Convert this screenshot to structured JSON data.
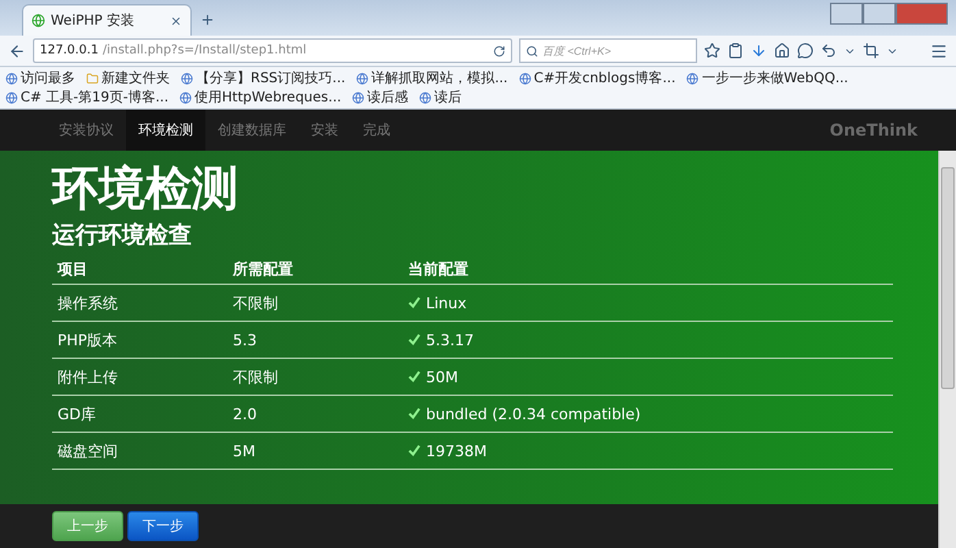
{
  "browser": {
    "tab": {
      "title": "WeiPHP 安装"
    },
    "address": {
      "host": "127.0.0.1",
      "path": "/install.php?s=/Install/step1.html"
    },
    "search": {
      "placeholder": "百度 <Ctrl+K>"
    },
    "bookmarks": [
      "访问最多",
      "新建文件夹",
      "【分享】RSS订阅技巧...",
      "详解抓取网站，模拟...",
      "C#开发cnblogs博客...",
      "一步一步来做WebQQ...",
      "C# 工具-第19页-博客...",
      "使用HttpWebreques...",
      "读后感",
      "读后"
    ]
  },
  "nav": {
    "steps": [
      {
        "label": "安装协议",
        "selected": false
      },
      {
        "label": "环境检测",
        "selected": true
      },
      {
        "label": "创建数据库",
        "selected": false
      },
      {
        "label": "安装",
        "selected": false
      },
      {
        "label": "完成",
        "selected": false
      }
    ],
    "brand": "OneThink"
  },
  "page": {
    "title": "环境检测",
    "subtitle": "运行环境检查",
    "table": {
      "columns": [
        "项目",
        "所需配置",
        "当前配置"
      ],
      "rows": [
        {
          "cells": [
            "操作系统",
            "不限制",
            "Linux"
          ],
          "ok": true
        },
        {
          "cells": [
            "PHP版本",
            "5.3",
            "5.3.17"
          ],
          "ok": true
        },
        {
          "cells": [
            "附件上传",
            "不限制",
            "50M"
          ],
          "ok": true
        },
        {
          "cells": [
            "GD库",
            "2.0",
            "bundled (2.0.34 compatible)"
          ],
          "ok": true
        },
        {
          "cells": [
            "磁盘空间",
            "5M",
            "19738M"
          ],
          "ok": true
        }
      ]
    }
  },
  "footer": {
    "buttons": [
      {
        "label": "上一步",
        "kind": "prev"
      },
      {
        "label": "下一步",
        "kind": "next"
      }
    ]
  }
}
